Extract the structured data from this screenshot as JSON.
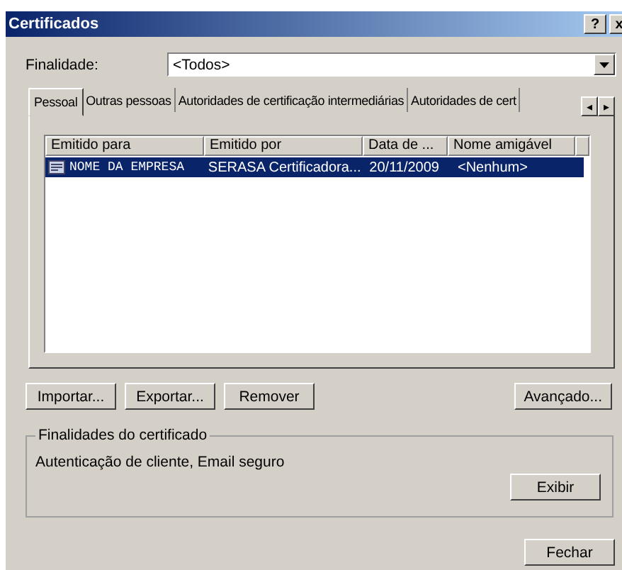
{
  "window": {
    "title": "Certificados",
    "help_button": "?",
    "close_button": "x"
  },
  "purpose": {
    "label": "Finalidade:",
    "value": "<Todos>"
  },
  "tabs": [
    {
      "label": "Pessoal",
      "selected": true
    },
    {
      "label": "Outras pessoas",
      "selected": false
    },
    {
      "label": "Autoridades de certificação intermediárias",
      "selected": false
    },
    {
      "label": "Autoridades de cert",
      "selected": false
    }
  ],
  "tab_scroll": {
    "left": "◂",
    "right": "▸"
  },
  "table": {
    "columns": [
      "Emitido para",
      "Emitido por",
      "Data de ...",
      "Nome amigável"
    ],
    "rows": [
      {
        "cells": [
          "NOME DA EMPRESA",
          "SERASA Certificadora...",
          "20/11/2009",
          "<Nenhum>"
        ],
        "selected": true
      }
    ]
  },
  "buttons": [
    "Importar...",
    "Exportar...",
    "Remover"
  ],
  "advanced_button": "Avançado...",
  "purposes_group": {
    "title": "Finalidades do certificado",
    "text": "Autenticação de cliente, Email seguro",
    "button": "Exibir"
  },
  "close_button": "Fechar"
}
